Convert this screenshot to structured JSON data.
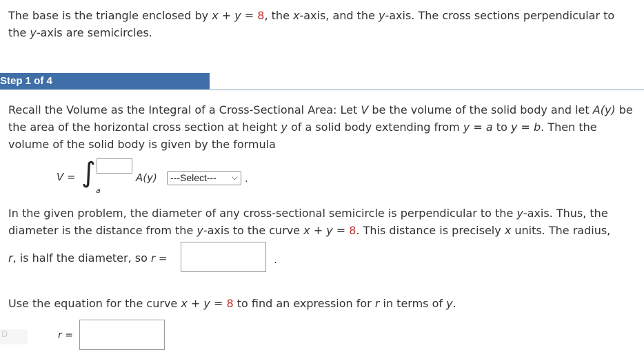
{
  "problem": {
    "part1": "The base is the triangle enclosed by ",
    "eq1_lhs": "x + y = ",
    "eq1_rhs": "8",
    "part2": ",  the ",
    "x_var": "x",
    "part3": "-axis, and the ",
    "y_var": "y",
    "part4": "-axis. The cross sections perpendicular to the ",
    "y_var2": "y",
    "part5": "-axis are semicircles."
  },
  "step": {
    "label": "Step 1 of 4"
  },
  "recall": {
    "t1": "Recall the Volume as the Integral of a Cross-Sectional Area: Let ",
    "V": "V",
    "t2": " be the volume of the solid body and let ",
    "Ay": "A(y)",
    "t3": " be the area of the horizontal cross section at height ",
    "y": "y",
    "t4": " of a solid body extending from ",
    "eq_a": "y = a",
    "t5": " to ",
    "eq_b": "y = b",
    "t6": ".  Then the volume of the solid body is given by the formula"
  },
  "formula": {
    "lhs": "V =",
    "integral": "∫",
    "lower": "a",
    "integrand": "A(y)",
    "select_value": "---Select---",
    "period": "."
  },
  "diameter": {
    "t1": "In the given problem, the diameter of any cross-sectional semicircle is perpendicular to the ",
    "y": "y",
    "t2": "-axis. Thus, the diameter is the distance from the ",
    "y2": "y",
    "t3": "-axis to the curve ",
    "eq_lhs": "x + y = ",
    "eq_rhs": "8",
    "t4": ".  This distance is precisely ",
    "x": "x",
    "t5": " units. The radius,",
    "t6": "r",
    "t7": ", is half the diameter, so ",
    "r_eq": "r =",
    "period": "."
  },
  "use_eq": {
    "t1": "Use the equation for the curve ",
    "eq_lhs": "x + y = ",
    "eq_rhs": "8",
    "t2": " to find an expression for ",
    "r": "r",
    "t3": " in terms of ",
    "y": "y",
    "t4": "."
  },
  "r_input": {
    "label": "r ="
  },
  "left_fade": {
    "text": "D"
  }
}
